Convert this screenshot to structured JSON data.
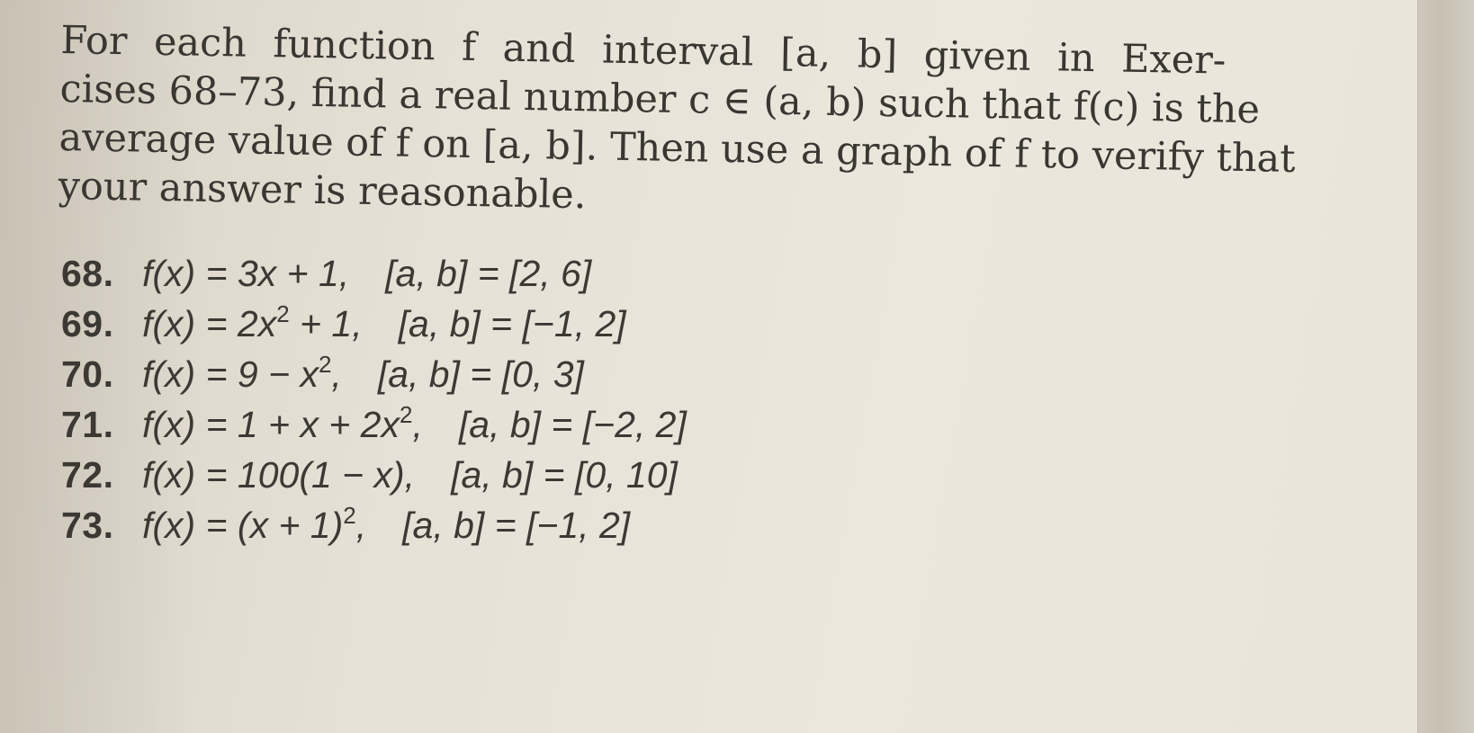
{
  "instructions": {
    "lines": [
      "For each function f and interval [a, b] given in Exer-",
      "cises 68–73, find a real number c ∈ (a, b) such that f(c) is the",
      "average value of f on [a, b]. Then use a graph of f to verify that",
      "your answer is reasonable."
    ]
  },
  "exercises": [
    {
      "number": "68.",
      "function": "f(x) = 3x + 1,",
      "interval": "[a, b] = [2, 6]"
    },
    {
      "number": "69.",
      "function_pre": "f(x) = 2x",
      "sup": "2",
      "function_post": " + 1,",
      "interval": "[a, b] = [−1, 2]"
    },
    {
      "number": "70.",
      "function_pre": "f(x) = 9 − x",
      "sup": "2",
      "function_post": ",",
      "interval": "[a, b] = [0, 3]"
    },
    {
      "number": "71.",
      "function_pre": "f(x) = 1 + x + 2x",
      "sup": "2",
      "function_post": ",",
      "interval": "[a, b] = [−2, 2]"
    },
    {
      "number": "72.",
      "function": "f(x) = 100(1 − x),",
      "interval": "[a, b] = [0, 10]"
    },
    {
      "number": "73.",
      "function_pre": "f(x) = (x + 1)",
      "sup": "2",
      "function_post": ",",
      "interval": "[a, b] = [−1, 2]"
    }
  ]
}
